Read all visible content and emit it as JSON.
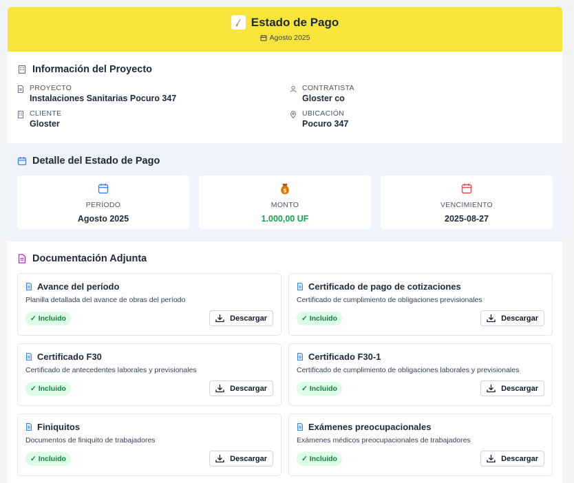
{
  "header": {
    "title": "Estado de Pago",
    "subtitle": "Agosto 2025",
    "logo_icon": "paintbrush-icon",
    "bg_color": "#f7e53c"
  },
  "info": {
    "title": "Información del Proyecto",
    "items": [
      {
        "label": "PROYECTO",
        "value": "Instalaciones Sanitarias Pocuro 347",
        "icon": "document-icon"
      },
      {
        "label": "CONTRATISTA",
        "value": "Gloster co",
        "icon": "user-icon"
      },
      {
        "label": "CLIENTE",
        "value": "Gloster",
        "icon": "building-icon"
      },
      {
        "label": "UBICACIÓN",
        "value": "Pocuro 347",
        "icon": "map-pin-icon"
      }
    ]
  },
  "detail": {
    "title": "Detalle del Estado de Pago",
    "stats": [
      {
        "label": "PERÍODO",
        "value": "Agosto 2025",
        "icon": "calendar-icon"
      },
      {
        "label": "MONTO",
        "value": "1.000,00 UF",
        "icon": "money-bag-icon"
      },
      {
        "label": "VENCIMIENTO",
        "value": "2025-08-27",
        "icon": "calendar-icon"
      }
    ]
  },
  "docs": {
    "title": "Documentación Adjunta",
    "badge_label": "✓ Incluido",
    "download_label": "Descargar",
    "items": [
      {
        "title": "Avance del período",
        "desc": "Planilla detallada del avance de obras del período"
      },
      {
        "title": "Certificado de pago de cotizaciones",
        "desc": "Certificado de cumplimiento de obligaciones previsionales"
      },
      {
        "title": "Certificado F30",
        "desc": "Certificado de antecedentes laborales y previsionales"
      },
      {
        "title": "Certificado F30-1",
        "desc": "Certificado de cumplimiento de obligaciones laborales y previsionales"
      },
      {
        "title": "Finiquitos",
        "desc": "Documentos de finiquito de trabajadores"
      },
      {
        "title": "Exámenes preocupacionales",
        "desc": "Exámenes médicos preocupacionales de trabajadores"
      }
    ]
  }
}
